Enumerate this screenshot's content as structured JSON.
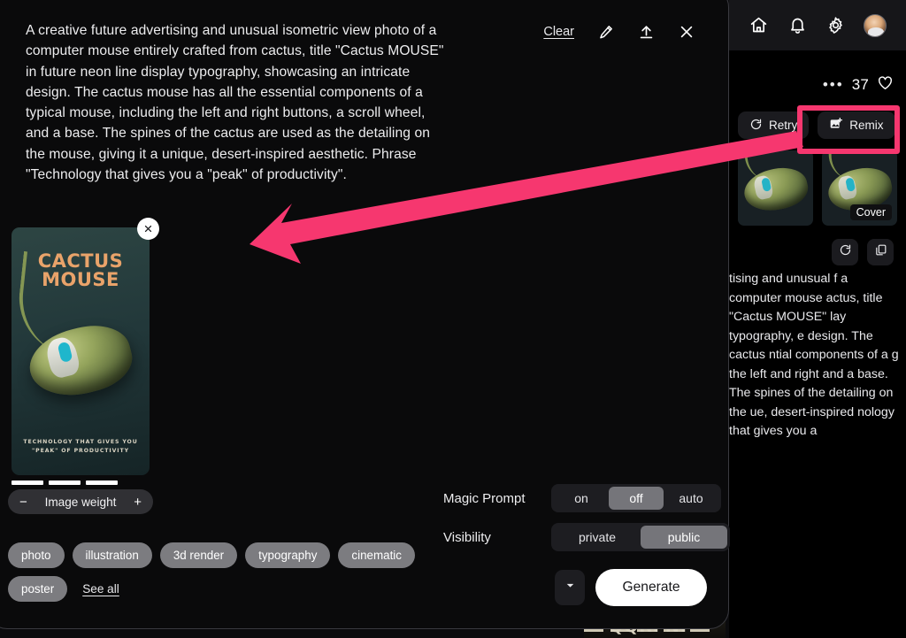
{
  "app": {
    "topbar_icons": [
      "home-icon",
      "bell-icon",
      "gear-icon",
      "avatar"
    ],
    "accent_color": "#f6376f",
    "background": "#0b0b0d"
  },
  "right_panel": {
    "like_count": "37",
    "like_icon": "heart-icon",
    "more_icon": "ellipsis-icon",
    "actions": [
      {
        "label": "Retry",
        "icon": "refresh-icon"
      },
      {
        "label": "Remix",
        "icon": "image-plus-icon"
      }
    ],
    "thumbnails": [
      {
        "badge": ""
      },
      {
        "badge": "Cover"
      }
    ],
    "icon_buttons": [
      {
        "icon": "refresh-icon"
      },
      {
        "icon": "copy-icon"
      }
    ],
    "description": "tising and unusual f a computer mouse actus, title \"Cactus MOUSE\" lay typography, e design. The cactus ntial components of a g the left and right and a base. The spines of the detailing on the ue, desert-inspired nology that gives you a",
    "bottom_image_text": "QQRFNI"
  },
  "modal": {
    "prompt": "A creative future advertising and unusual isometric view photo of a computer mouse entirely crafted from cactus, title \"Cactus MOUSE\" in future neon line display typography, showcasing an intricate design. The cactus mouse has all the essential components of a typical mouse, including the left and right buttons, a scroll wheel, and a base. The spines of the cactus are used as the detailing on the mouse, giving it a unique, desert-inspired aesthetic. Phrase \"Technology that gives you a \"peak\" of productivity\".",
    "header_tools": {
      "clear_label": "Clear",
      "edit_icon": "pencil-icon",
      "upload_icon": "upload-icon",
      "close_icon": "close-icon"
    },
    "reference_image": {
      "title_line1": "CACTUS",
      "title_line2": "MOUSE",
      "tagline_line1": "TECHNOLOGY THAT GIVES YOU",
      "tagline_line2": "\"PEAK\" OF PRODUCTIVITY",
      "remove_icon": "close-icon"
    },
    "image_weight": {
      "label": "Image weight",
      "minus": "−",
      "plus": "+",
      "segments": 3
    },
    "tags": [
      "photo",
      "illustration",
      "3d render",
      "typography",
      "cinematic",
      "poster"
    ],
    "see_all_label": "See all",
    "controls": [
      {
        "label": "Magic Prompt",
        "options": [
          "on",
          "off",
          "auto"
        ],
        "selected": "off"
      },
      {
        "label": "Visibility",
        "options": [
          "private",
          "public"
        ],
        "selected": "public"
      }
    ],
    "generate": {
      "label": "Generate",
      "caret_icon": "chevron-down-icon"
    }
  },
  "annotation": {
    "highlight_target": "Remix",
    "arrow_color": "#f6376f",
    "box_color": "#f6376f"
  }
}
